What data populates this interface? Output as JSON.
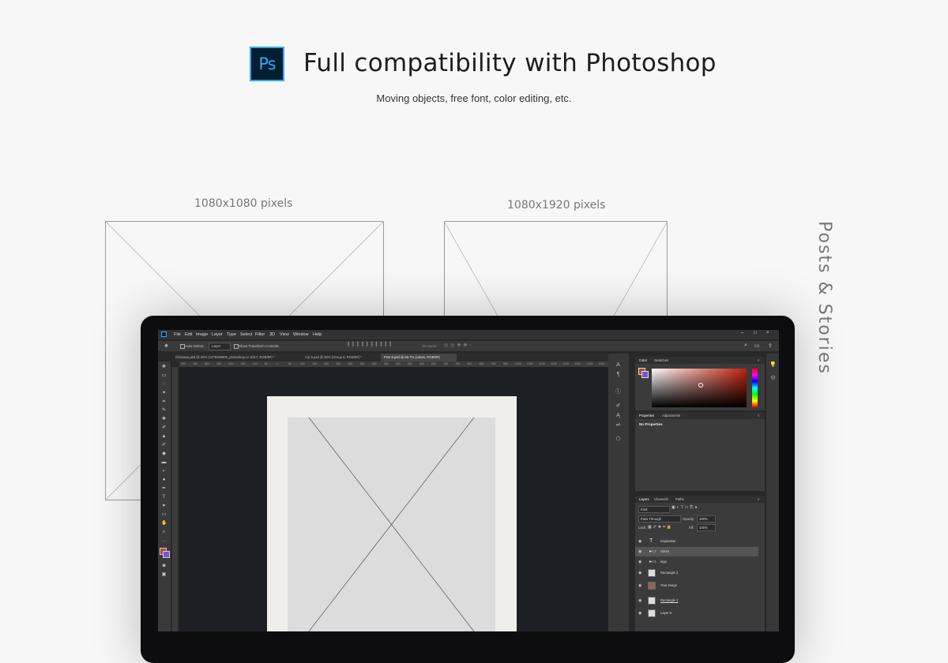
{
  "header": {
    "logo_text": "Ps",
    "title": "Full compatibility with Photoshop",
    "subtitle": "Moving objects, free font, color editing, etc."
  },
  "formats": {
    "square_label": "1080x1080 pixels",
    "story_label": "1080x1920 pixels"
  },
  "side_label": "Posts & Stories",
  "photoshop": {
    "menu": [
      "File",
      "Edit",
      "Image",
      "Layer",
      "Type",
      "Select",
      "Filter",
      "3D",
      "View",
      "Window",
      "Help"
    ],
    "options": {
      "auto_select": "Auto-Select:",
      "auto_select_value": "Layer",
      "transform": "Show Transform Controls",
      "mode_3d": "3D Mode:"
    },
    "tabs": [
      {
        "label": "Обложка.psd @ 25% (1478160600_photoshop-cc-2017, RGB/8#) *"
      },
      {
        "label": "стр 9.psd @ 50% (Group 5, RGB/8#) *"
      },
      {
        "label": "Post 6.psd @ 66.7% (colors, RGB/8#)"
      }
    ],
    "ruler": [
      "400",
      "350",
      "300",
      "250",
      "200",
      "150",
      "100",
      "50",
      "0",
      "50",
      "100",
      "150",
      "200",
      "250",
      "300",
      "350",
      "400",
      "450",
      "500",
      "550",
      "600",
      "650",
      "700",
      "750",
      "800",
      "850",
      "900",
      "950",
      "1000",
      "1050",
      "1100",
      "1150",
      "1200",
      "1250",
      "1300",
      "1350",
      "140"
    ],
    "color_panel": {
      "tabs": [
        "Color",
        "Swatches"
      ],
      "base_color": "#b01e0e"
    },
    "properties_panel": {
      "tabs": [
        "Properties",
        "Adjustments"
      ],
      "empty_text": "No Properties"
    },
    "layers_panel": {
      "tabs": [
        "Layers",
        "Channels",
        "Paths"
      ],
      "kind": "Kind",
      "blend_mode": "Pass Through",
      "opacity_label": "Opacity:",
      "opacity_value": "100%",
      "lock_label": "Lock:",
      "fill_label": "Fill:",
      "fill_value": "100%",
      "layers": [
        {
          "name": "Inspiration",
          "type": "text"
        },
        {
          "name": "colors",
          "type": "group"
        },
        {
          "name": "logo",
          "type": "group"
        },
        {
          "name": "Rectangle 2",
          "type": "shape"
        },
        {
          "name": "Your image",
          "type": "image"
        },
        {
          "name": "Rectangle 1",
          "type": "shape"
        },
        {
          "name": "Layer 0",
          "type": "image"
        }
      ]
    }
  }
}
